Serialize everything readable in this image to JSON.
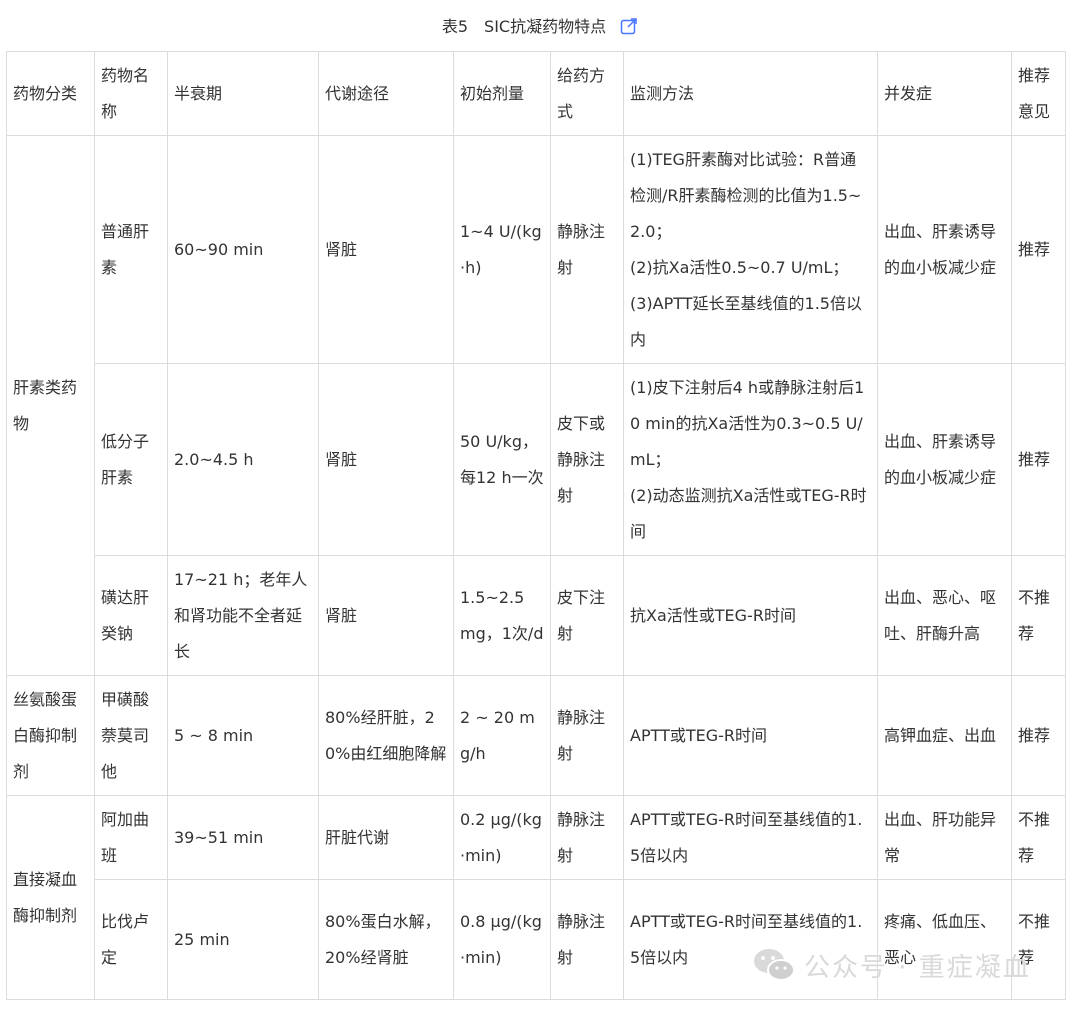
{
  "caption": {
    "title": "表5　SIC抗凝药物特点",
    "icon": "external-link-icon",
    "accent_color": "#4a74ff"
  },
  "table": {
    "headers": [
      "药物分类",
      "药物名称",
      "半衰期",
      "代谢途径",
      "初始剂量",
      "给药方式",
      "监测方法",
      "并发症",
      "推荐意见"
    ],
    "groups": [
      {
        "category": "肝素类药物",
        "rows": [
          [
            "普通肝素",
            "60~90 min",
            "肾脏",
            "1~4 U/(kg·h)",
            "静脉注射",
            "(1)TEG肝素酶对比试验：R普通检测/R肝素酶检测的比值为1.5~2.0；\n(2)抗Xa活性0.5~0.7 U/mL；\n(3)APTT延长至基线值的1.5倍以内",
            "出血、肝素诱导的血小板减少症",
            "推荐"
          ],
          [
            "低分子肝素",
            "2.0~4.5 h",
            "肾脏",
            "50 U/kg，每12 h一次",
            "皮下或静脉注射",
            "(1)皮下注射后4 h或静脉注射后10 min的抗Xa活性为0.3~0.5 U/mL；\n(2)动态监测抗Xa活性或TEG-R时间",
            "出血、肝素诱导的血小板减少症",
            "推荐"
          ],
          [
            "磺达肝癸钠",
            "17~21 h；老年人和肾功能不全者延长",
            "肾脏",
            "1.5~2.5 mg，1次/d",
            "皮下注射",
            "抗Xa活性或TEG-R时间",
            "出血、恶心、呕吐、肝酶升高",
            "不推荐"
          ]
        ]
      },
      {
        "category": "丝氨酸蛋白酶抑制剂",
        "rows": [
          [
            "甲磺酸萘莫司他",
            "5 ~ 8 min",
            "80%经肝脏，20%由红细胞降解",
            "2 ~ 20 mg/h",
            "静脉注射",
            "APTT或TEG-R时间",
            "高钾血症、出血",
            "推荐"
          ]
        ]
      },
      {
        "category": "直接凝血酶抑制剂",
        "rows": [
          [
            "阿加曲班",
            "39~51 min",
            "肝脏代谢",
            "0.2 μg/(kg·min)",
            "静脉注射",
            "APTT或TEG-R时间至基线值的1.5倍以内",
            "出血、肝功能异常",
            "不推荐"
          ],
          [
            "比伐卢定",
            "25 min",
            "80%蛋白水解，20%经肾脏",
            "0.8 μg/(kg·min)",
            "静脉注射",
            "APTT或TEG-R时间至基线值的1.5倍以内",
            "疼痛、低血压、恶心",
            "不推荐"
          ]
        ]
      }
    ]
  },
  "watermark": {
    "text": "公众号 · 重症凝血",
    "icon": "wechat-icon"
  }
}
